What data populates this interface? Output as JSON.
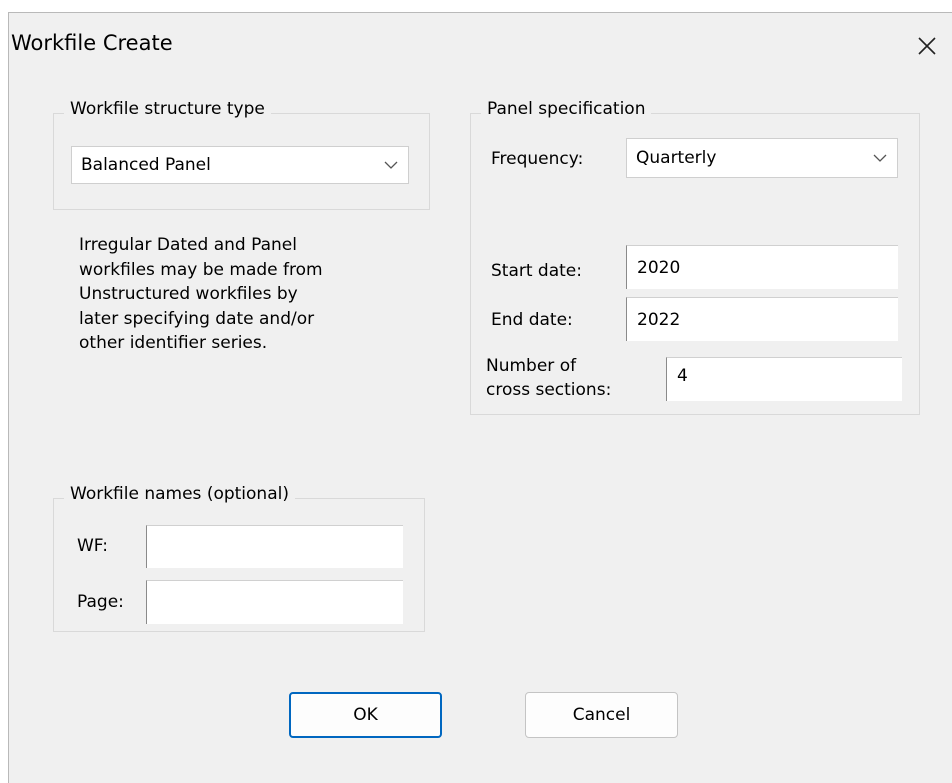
{
  "window": {
    "title": "Workfile Create"
  },
  "structure": {
    "legend": "Workfile structure type",
    "selected": "Balanced Panel"
  },
  "note": [
    "Irregular Dated and Panel",
    "workfiles may be made from",
    "Unstructured workfiles by",
    "later specifying date and/or",
    "other identifier series."
  ],
  "panel": {
    "legend": "Panel specification",
    "frequency_label": "Frequency:",
    "frequency_value": "Quarterly",
    "start_label": "Start date:",
    "start_value": "2020",
    "end_label": "End date:",
    "end_value": "2022",
    "cross_label_1": "Number of",
    "cross_label_2": "cross sections:",
    "cross_value": "4"
  },
  "names": {
    "legend": "Workfile names (optional)",
    "wf_label": "WF:",
    "wf_value": "",
    "page_label": "Page:",
    "page_value": ""
  },
  "buttons": {
    "ok": "OK",
    "cancel": "Cancel"
  }
}
